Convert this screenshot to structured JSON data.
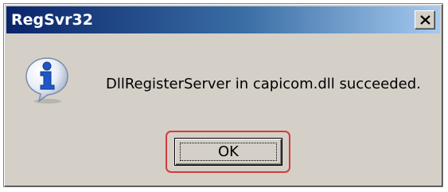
{
  "window": {
    "title": "RegSvr32"
  },
  "titlebar": {
    "close_icon": "close-x-icon",
    "gradient_start": "#0a246a",
    "gradient_end": "#a6caf0"
  },
  "content": {
    "icon": "information-icon",
    "message": "DllRegisterServer in capicom.dll succeeded."
  },
  "buttons": {
    "ok_label": "OK"
  },
  "highlight": {
    "color": "#d33b3b"
  }
}
